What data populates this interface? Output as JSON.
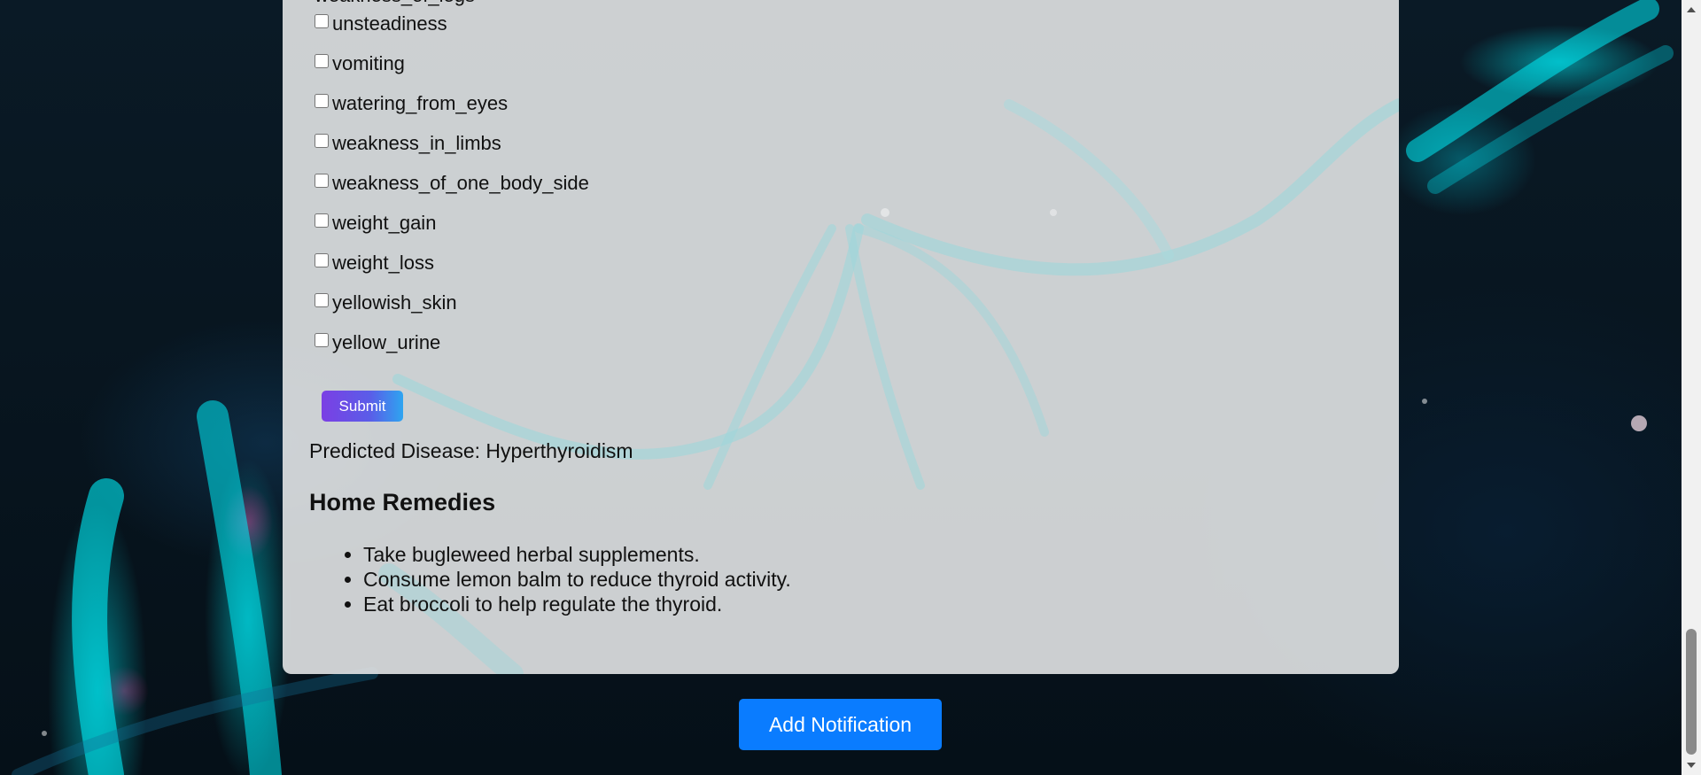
{
  "symptoms": {
    "clipped_label": "weakness_of_legs",
    "items": [
      {
        "label": "unsteadiness",
        "checked": false
      },
      {
        "label": "vomiting",
        "checked": false
      },
      {
        "label": "watering_from_eyes",
        "checked": false
      },
      {
        "label": "weakness_in_limbs",
        "checked": false
      },
      {
        "label": "weakness_of_one_body_side",
        "checked": false
      },
      {
        "label": "weight_gain",
        "checked": false
      },
      {
        "label": "weight_loss",
        "checked": false
      },
      {
        "label": "yellowish_skin",
        "checked": false
      },
      {
        "label": "yellow_urine",
        "checked": false
      }
    ]
  },
  "form": {
    "submit_label": "Submit"
  },
  "result": {
    "predicted_text": "Predicted Disease: Hyperthyroidism",
    "remedies_title": "Home Remedies",
    "remedies": [
      "Take bugleweed herbal supplements.",
      "Consume lemon balm to reduce thyroid activity.",
      "Eat broccoli to help regulate the thyroid."
    ]
  },
  "footer": {
    "notification_label": "Add Notification"
  },
  "colors": {
    "submit_gradient_start": "#7b3fe4",
    "submit_gradient_end": "#2ea5f0",
    "notification_button": "#0a7cff",
    "card_background": "#e2e4e6"
  }
}
